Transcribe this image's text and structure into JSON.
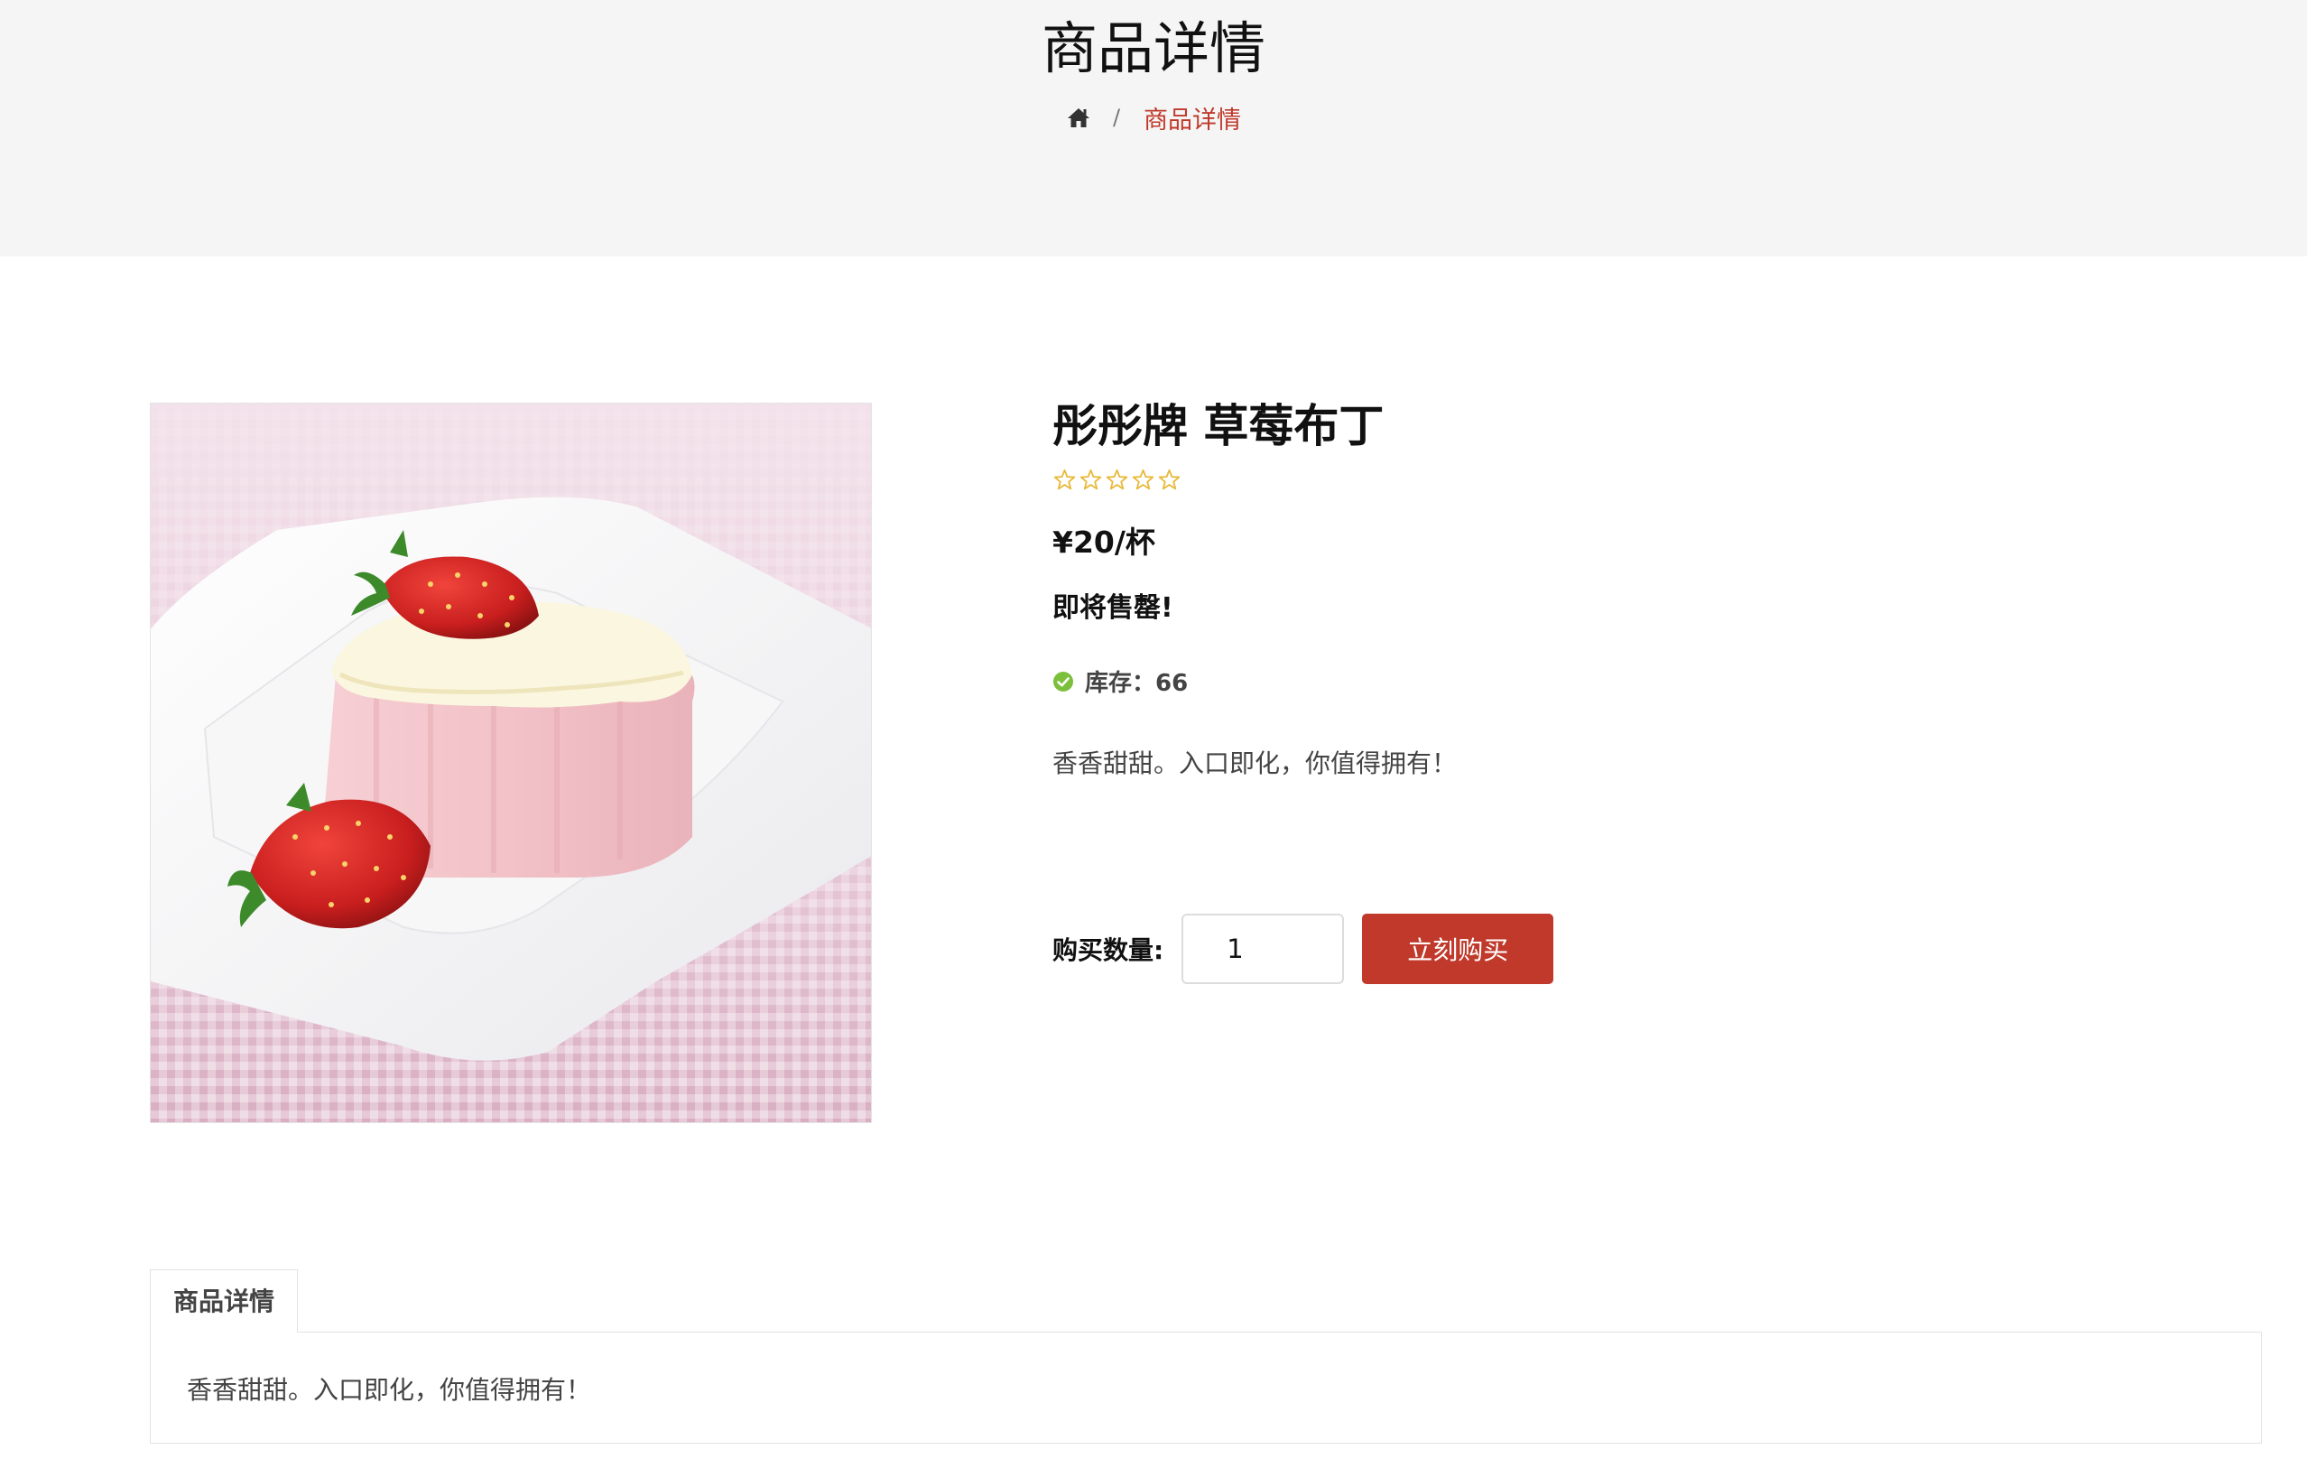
{
  "header": {
    "title": "商品详情",
    "breadcrumb": {
      "home_icon": "home-icon",
      "separator": "/",
      "current": "商品详情"
    }
  },
  "product": {
    "image": "strawberry-pudding-photo",
    "name": "彤彤牌 草莓布丁",
    "rating": {
      "value": 0,
      "max": 5
    },
    "price": "¥20/杯",
    "status": "即将售罄!",
    "stock_icon": "check-circle-icon",
    "stock_label": "库存：66",
    "short_description": "香香甜甜。入口即化，你值得拥有！",
    "quantity_label": "购买数量:",
    "quantity_value": "1",
    "buy_button": "立刻购买"
  },
  "tabs": [
    {
      "label": "商品详情",
      "content": "香香甜甜。入口即化，你值得拥有！"
    }
  ],
  "colors": {
    "accent": "#c0392b",
    "star": "#e8b838",
    "stock_check": "#7cbf3a",
    "banner_bg": "#f5f5f5"
  }
}
